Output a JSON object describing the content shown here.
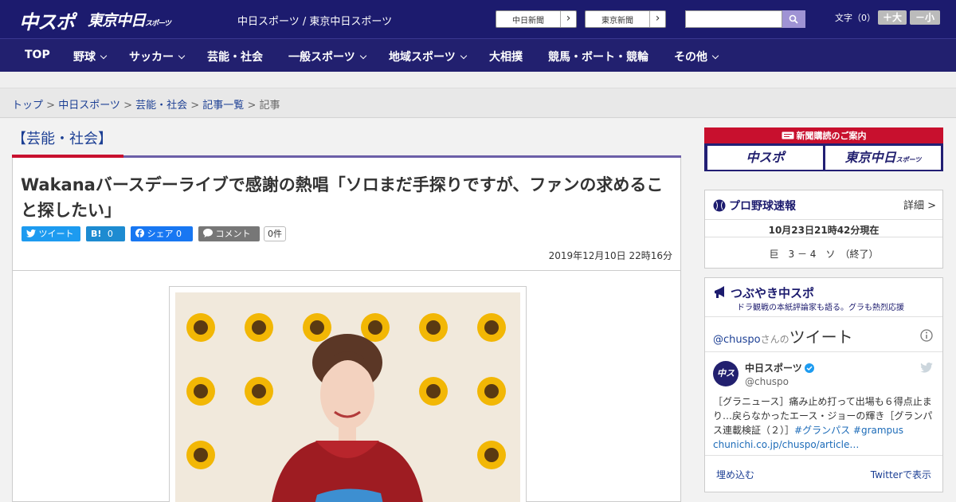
{
  "header": {
    "logo_chuspo": "中スポ",
    "logo_tokyo": "東京中日",
    "logo_tokyo_sub": "スポーツ",
    "site_links": "中日スポーツ / 東京中日スポーツ",
    "pill_chunichi": "中日新聞",
    "pill_tokyo": "東京新聞",
    "search_placeholder": "",
    "fontsize_label": "文字（0）",
    "font_bigger": "＋大",
    "font_smaller": "－小"
  },
  "nav": {
    "items": [
      "TOP",
      "野球",
      "サッカー",
      "芸能・社会",
      "一般スポーツ",
      "地域スポーツ",
      "大相撲",
      "競馬・ボート・競輪",
      "その他"
    ]
  },
  "breadcrumb": {
    "top": "トップ",
    "chunichi_sports": "中日スポーツ",
    "category": "芸能・社会",
    "list": "記事一覧",
    "current": "記事",
    "sep": " > "
  },
  "article": {
    "section": "【芸能・社会】",
    "headline": "Wakanaバースデーライブで感謝の熱唱「ソロまだ手探りですが、ファンの求めること探したい」",
    "tweet_label": "ツイート",
    "hatena_label": "B!",
    "hatena_count": "0",
    "fb_label": "シェア",
    "fb_count": "0",
    "comment_label": "コメント",
    "comment_count": "0件",
    "datetime": "2019年12月10日 22時16分"
  },
  "sidebar": {
    "subscription_head": "新聞購読のご案内",
    "sub_chuspo": "中スポ",
    "sub_tokyo": "東京中日",
    "sub_tokyo_small": "スポーツ",
    "baseball_title": "プロ野球速報",
    "baseball_detail": "詳細 >",
    "baseball_time": "10月23日21時42分現在",
    "baseball_score": "巨　3 － 4　ソ　（終了）",
    "tw_title": "つぶやき中スポ",
    "tw_subtitle": "ドラ観戦の本紙評論家も語る。グラも熱烈応援",
    "tw_handle_link": "@chuspo",
    "tw_handle_suffix": "さんの",
    "tw_word": "ツイート",
    "tw_avatar": "中スポ",
    "tw_name": "中日スポーツ",
    "tw_user": "@chuspo",
    "tw_text": "［グラニュース］痛み止め打って出場も６得点止まり…戻らなかったエース・ジョーの輝き［グランパス連載検証（２）］",
    "tw_tag1": "#グランパス",
    "tw_tag2": "#grampus",
    "tw_link": "chunichi.co.jp/chuspo/article…",
    "tw_embed": "埋め込む",
    "tw_view": "Twitterで表示"
  },
  "colors": {
    "header_bg": "#1c1b6e",
    "accent_red": "#c8102e",
    "link_blue": "#1c3f94"
  }
}
